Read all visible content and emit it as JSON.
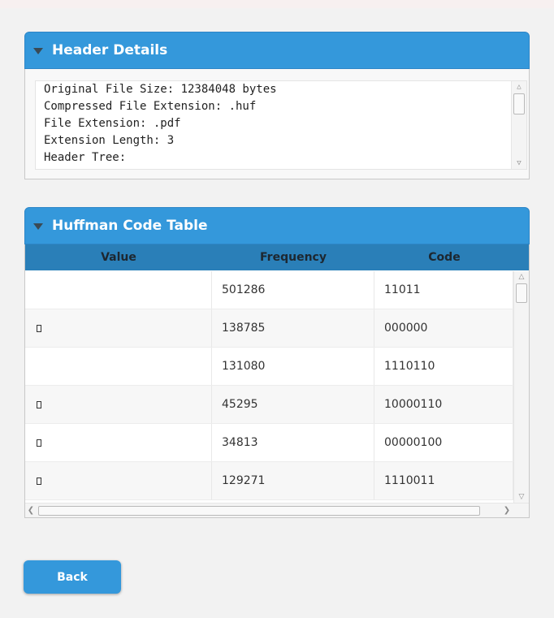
{
  "header_details": {
    "title": "Header Details",
    "lines": [
      "Original File Size: 12384048 bytes",
      "Compressed File Extension: .huf",
      "File Extension: .pdf",
      "Extension Length: 3",
      "Header Tree:"
    ]
  },
  "huffman_table": {
    "title": "Huffman Code Table",
    "columns": [
      "Value",
      "Frequency",
      "Code"
    ],
    "rows": [
      {
        "value": "",
        "frequency": "501286",
        "code": "11011",
        "glyph": false
      },
      {
        "value": "",
        "frequency": "138785",
        "code": "000000",
        "glyph": true
      },
      {
        "value": "",
        "frequency": "131080",
        "code": "1110110",
        "glyph": false
      },
      {
        "value": "",
        "frequency": "45295",
        "code": "10000110",
        "glyph": true
      },
      {
        "value": "",
        "frequency": "34813",
        "code": "00000100",
        "glyph": true
      },
      {
        "value": "",
        "frequency": "129271",
        "code": "1110011",
        "glyph": true
      }
    ]
  },
  "buttons": {
    "back_label": "Back"
  },
  "colors": {
    "accent": "#3498db",
    "table_header": "#2a7fb8"
  }
}
